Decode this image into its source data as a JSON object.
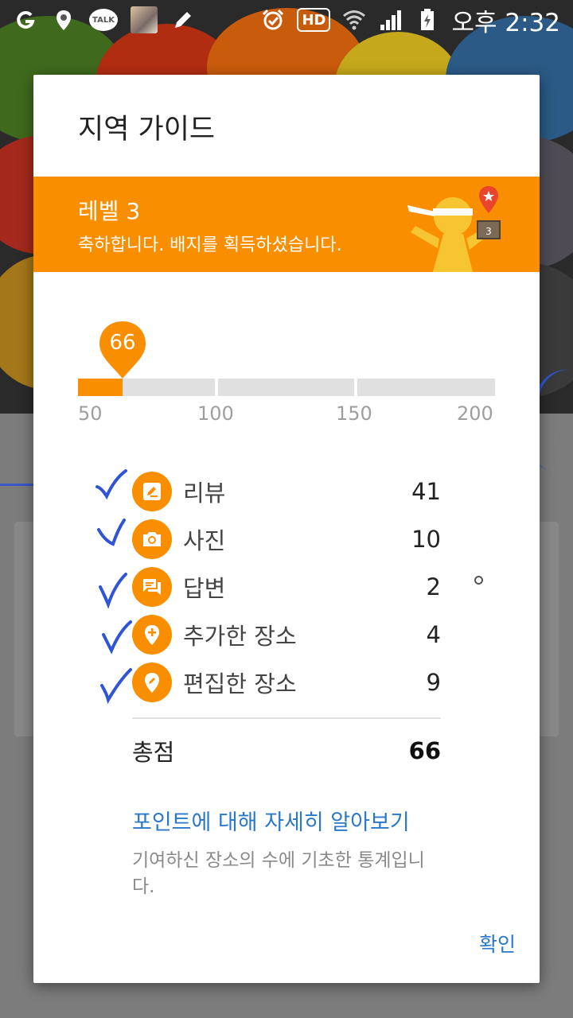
{
  "status_bar": {
    "talk_label": "TALK",
    "hd_label": "HD",
    "time": "오후 2:32",
    "icons": [
      "g-app-icon",
      "location-pin-icon",
      "kakaotalk-icon",
      "app-avatar-icon",
      "edit-pencil-icon",
      "alarm-clock-icon",
      "hd-voice-icon",
      "wifi-icon",
      "signal-icon",
      "battery-charging-icon"
    ]
  },
  "dialog": {
    "title": "지역 가이드",
    "level": {
      "title": "레벨 3",
      "message": "축하합니다. 배지를 획득하셨습니다.",
      "badge_number": "3"
    },
    "progress": {
      "current": "66",
      "min": 50,
      "max": 200,
      "ticks": [
        "50",
        "100",
        "150",
        "200"
      ]
    },
    "stats": [
      {
        "label": "리뷰",
        "value": "41",
        "icon": "review-pencil-icon"
      },
      {
        "label": "사진",
        "value": "10",
        "icon": "camera-icon"
      },
      {
        "label": "답변",
        "value": "2",
        "icon": "chat-bubble-icon"
      },
      {
        "label": "추가한 장소",
        "value": "4",
        "icon": "add-place-icon"
      },
      {
        "label": "편집한 장소",
        "value": "9",
        "icon": "edit-place-icon"
      }
    ],
    "total": {
      "label": "총점",
      "value": "66"
    },
    "learn_more": "포인트에 대해 자세히 알아보기",
    "footnote": "기여하신 장소의 수에 기초한 통계입니다.",
    "confirm": "확인"
  },
  "colors": {
    "accent_orange": "#f98f00",
    "link_blue": "#2a78c9",
    "check_blue": "#2f55d6"
  }
}
